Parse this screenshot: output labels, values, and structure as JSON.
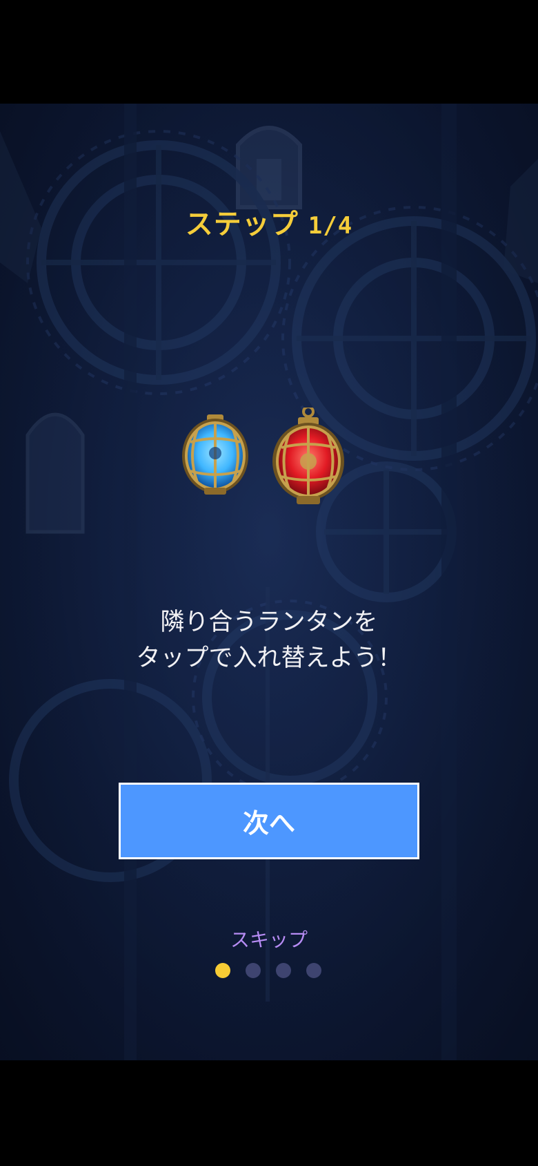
{
  "tutorial": {
    "step_label": "ステップ",
    "step_counter": "1/4",
    "instruction_line1": "隣り合うランタンを",
    "instruction_line2": "タップで入れ替えよう！",
    "next_label": "次へ",
    "skip_label": "スキップ",
    "current_page": 1,
    "total_pages": 4
  },
  "lanterns": [
    {
      "name": "blue-lantern",
      "glass_color": "#3fb6ff"
    },
    {
      "name": "red-lantern",
      "glass_color": "#e21b24"
    }
  ],
  "colors": {
    "title": "#f5cd3a",
    "button": "#4d97ff",
    "skip": "#b78cf4",
    "dot_active": "#f7cc35",
    "dot_inactive": "#3e4470"
  }
}
